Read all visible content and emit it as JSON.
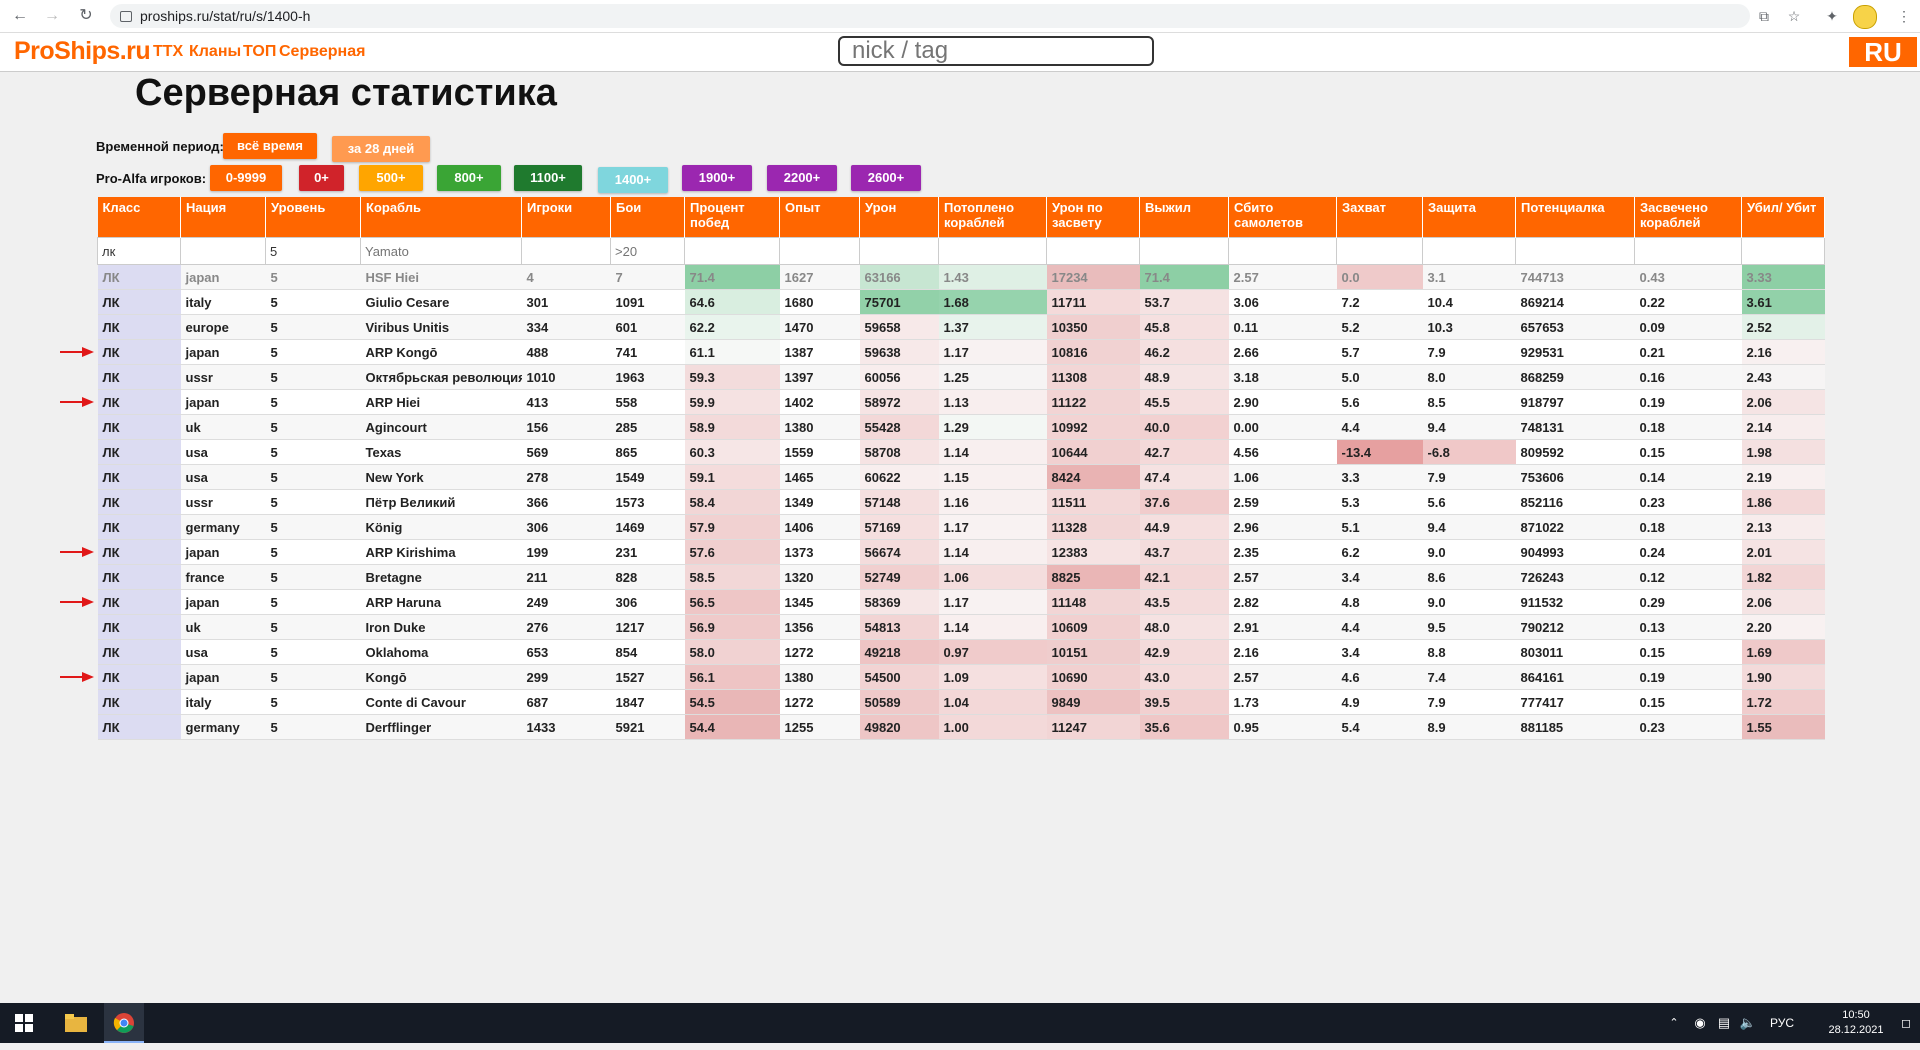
{
  "browser": {
    "url": "proships.ru/stat/ru/s/1400-h",
    "back_icon": "arrow-left-icon",
    "forward_icon": "arrow-right-icon",
    "reload_icon": "reload-icon",
    "toolbar_icons": [
      "share-icon",
      "star-icon",
      "puzzle-icon",
      "profile-icon"
    ]
  },
  "site": {
    "logo": "ProShips.ru",
    "menu": [
      "ТТХ",
      "Кланы",
      "ТОП",
      "Серверная"
    ],
    "search_placeholder": "nick / tag",
    "lang": "RU",
    "accent_color": "#ff6600"
  },
  "page": {
    "title": "Серверная статистика",
    "period_label": "Временной период:",
    "period_buttons": [
      {
        "label": "всё время",
        "color": "#ff6600",
        "active": true
      },
      {
        "label": "за 28 дней",
        "color": "#ff9a50",
        "active": false
      }
    ],
    "skill_label": "Pro-Alfa игроков:",
    "skill_buttons": [
      {
        "label": "0-9999",
        "color": "#ff6600"
      },
      {
        "label": "0+",
        "color": "#d0232a"
      },
      {
        "label": "500+",
        "color": "#ffa500"
      },
      {
        "label": "800+",
        "color": "#3aa535"
      },
      {
        "label": "1100+",
        "color": "#1f7a2e"
      },
      {
        "label": "1400+",
        "color": "#7fd6dd",
        "active": true
      },
      {
        "label": "1900+",
        "color": "#9b27b0"
      },
      {
        "label": "2200+",
        "color": "#9b27b0"
      },
      {
        "label": "2600+",
        "color": "#9b27b0"
      }
    ]
  },
  "table": {
    "headers": [
      "Класс",
      "Нация",
      "Уровень",
      "Корабль",
      "Игроки",
      "Бои",
      "Процент побед",
      "Опыт",
      "Урон",
      "Потоплено кораблей",
      "Урон по засвету",
      "Выжил",
      "Сбито самолетов",
      "Захват",
      "Защита",
      "Потенциалка",
      "Засвечено кораблей",
      "Убил/ Убит"
    ],
    "filters": [
      {
        "value": "лк",
        "placeholder": ""
      },
      {
        "value": "",
        "placeholder": ""
      },
      {
        "value": "5",
        "placeholder": ""
      },
      {
        "value": "",
        "placeholder": "Yamato"
      },
      {
        "value": "",
        "placeholder": ""
      },
      {
        "value": "",
        "placeholder": ">20"
      },
      {
        "value": "",
        "placeholder": ""
      },
      {
        "value": "",
        "placeholder": ""
      },
      {
        "value": "",
        "placeholder": ""
      },
      {
        "value": "",
        "placeholder": ""
      },
      {
        "value": "",
        "placeholder": ""
      },
      {
        "value": "",
        "placeholder": ""
      },
      {
        "value": "",
        "placeholder": ""
      },
      {
        "value": "",
        "placeholder": ""
      },
      {
        "value": "",
        "placeholder": ""
      },
      {
        "value": "",
        "placeholder": ""
      },
      {
        "value": "",
        "placeholder": ""
      },
      {
        "value": "",
        "placeholder": ""
      }
    ],
    "rows": [
      {
        "muted": true,
        "cells": [
          "ЛК",
          "japan",
          "5",
          "HSF Hiei",
          "4",
          "7",
          "71.4",
          "1627",
          "63166",
          "1.43",
          "17234",
          "71.4",
          "2.57",
          "0.0",
          "3.1",
          "744713",
          "0.43",
          "3.33"
        ],
        "colors": {
          "6": "#8dcfa5",
          "8": "#c7e6d2",
          "9": "#dff0e5",
          "10": "#e9bcbc",
          "11": "#8dcfa5",
          "13": "#efcaca",
          "17": "#8dcfa5"
        }
      },
      {
        "cells": [
          "ЛК",
          "italy",
          "5",
          "Giulio Cesare",
          "301",
          "1091",
          "64.6",
          "1680",
          "75701",
          "1.68",
          "11711",
          "53.7",
          "3.06",
          "7.2",
          "10.4",
          "869214",
          "0.22",
          "3.61"
        ],
        "colors": {
          "6": "#d9eee0",
          "8": "#92d1a9",
          "9": "#96d3ad",
          "10": "#f4dada",
          "11": "#f5e2e2",
          "17": "#92d1a9"
        }
      },
      {
        "cells": [
          "ЛК",
          "europe",
          "5",
          "Viribus Unitis",
          "334",
          "601",
          "62.2",
          "1470",
          "59658",
          "1.37",
          "10350",
          "45.8",
          "0.11",
          "5.2",
          "10.3",
          "657653",
          "0.09",
          "2.52"
        ],
        "colors": {
          "6": "#e9f4ed",
          "8": "#f7e9e9",
          "9": "#e8f3ec",
          "10": "#f0cfcf",
          "11": "#f5e0e0",
          "17": "#e3f1e8"
        }
      },
      {
        "arrow": true,
        "cells": [
          "ЛК",
          "japan",
          "5",
          "ARP Kongō",
          "488",
          "741",
          "61.1",
          "1387",
          "59638",
          "1.17",
          "10816",
          "46.2",
          "2.66",
          "5.7",
          "7.9",
          "929531",
          "0.21",
          "2.16"
        ],
        "colors": {
          "6": "#f6f8f6",
          "8": "#f7e9e9",
          "9": "#f8f2f2",
          "10": "#f1d2d2",
          "11": "#f5e0e0",
          "17": "#f8f0f0"
        }
      },
      {
        "cells": [
          "ЛК",
          "ussr",
          "5",
          "Октябрьская революция",
          "1010",
          "1963",
          "59.3",
          "1397",
          "60056",
          "1.25",
          "11308",
          "48.9",
          "3.18",
          "5.0",
          "8.0",
          "868259",
          "0.16",
          "2.43"
        ],
        "colors": {
          "6": "#f3dcdc",
          "8": "#f8eded",
          "9": "#f6f4f4",
          "10": "#f2d6d6",
          "11": "#f5e4e4",
          "17": "#f6f4f4"
        }
      },
      {
        "arrow": true,
        "cells": [
          "ЛК",
          "japan",
          "5",
          "ARP Hiei",
          "413",
          "558",
          "59.9",
          "1402",
          "58972",
          "1.13",
          "11122",
          "45.5",
          "2.90",
          "5.6",
          "8.5",
          "918797",
          "0.19",
          "2.06"
        ],
        "colors": {
          "6": "#f5e2e2",
          "8": "#f6e4e4",
          "9": "#f8eeee",
          "10": "#f2d4d4",
          "11": "#f5dfdf",
          "17": "#f5e4e4"
        }
      },
      {
        "cells": [
          "ЛК",
          "uk",
          "5",
          "Agincourt",
          "156",
          "285",
          "58.9",
          "1380",
          "55428",
          "1.29",
          "10992",
          "40.0",
          "0.00",
          "4.4",
          "9.4",
          "748131",
          "0.18",
          "2.14"
        ],
        "colors": {
          "6": "#f3dada",
          "8": "#f3d8d8",
          "9": "#f3f7f4",
          "10": "#f2d3d3",
          "11": "#f2d1d1",
          "17": "#f7eded"
        }
      },
      {
        "cells": [
          "ЛК",
          "usa",
          "5",
          "Texas",
          "569",
          "865",
          "60.3",
          "1559",
          "58708",
          "1.14",
          "10644",
          "42.7",
          "4.56",
          "-13.4",
          "-6.8",
          "809592",
          "0.15",
          "1.98"
        ],
        "colors": {
          "6": "#f6e6e6",
          "8": "#f6e3e3",
          "9": "#f8efef",
          "10": "#f1d0d0",
          "11": "#f4d9d9",
          "13": "#e6a0a0",
          "14": "#f0c8c8",
          "17": "#f4e0e0"
        }
      },
      {
        "cells": [
          "ЛК",
          "usa",
          "5",
          "New York",
          "278",
          "1549",
          "59.1",
          "1465",
          "60622",
          "1.15",
          "8424",
          "47.4",
          "1.06",
          "3.3",
          "7.9",
          "753606",
          "0.14",
          "2.19"
        ],
        "colors": {
          "6": "#f4dcdc",
          "8": "#f8eeee",
          "9": "#f8f0f0",
          "10": "#e9b3b3",
          "11": "#f5e2e2",
          "17": "#f8f0f0"
        }
      },
      {
        "cells": [
          "ЛК",
          "ussr",
          "5",
          "Пётр Великий",
          "366",
          "1573",
          "58.4",
          "1349",
          "57148",
          "1.16",
          "11511",
          "37.6",
          "2.59",
          "5.3",
          "5.6",
          "852116",
          "0.23",
          "1.86"
        ],
        "colors": {
          "6": "#f2d6d6",
          "8": "#f5dfdf",
          "9": "#f8f0f0",
          "10": "#f3d8d8",
          "11": "#f1cccc",
          "17": "#f3d8d8"
        }
      },
      {
        "cells": [
          "ЛК",
          "germany",
          "5",
          "König",
          "306",
          "1469",
          "57.9",
          "1406",
          "57169",
          "1.17",
          "11328",
          "44.9",
          "2.96",
          "5.1",
          "9.4",
          "871022",
          "0.18",
          "2.13"
        ],
        "colors": {
          "6": "#f1d1d1",
          "8": "#f5dfdf",
          "9": "#f8f2f2",
          "10": "#f2d6d6",
          "11": "#f5dfdf",
          "17": "#f7ecec"
        }
      },
      {
        "arrow": true,
        "cells": [
          "ЛК",
          "japan",
          "5",
          "ARP Kirishima",
          "199",
          "231",
          "57.6",
          "1373",
          "56674",
          "1.14",
          "12383",
          "43.7",
          "2.35",
          "6.2",
          "9.0",
          "904993",
          "0.24",
          "2.01"
        ],
        "colors": {
          "6": "#f0cfcf",
          "8": "#f4dcdc",
          "9": "#f8efef",
          "10": "#f6e3e3",
          "11": "#f4dcdc",
          "17": "#f5e3e3"
        }
      },
      {
        "cells": [
          "ЛК",
          "france",
          "5",
          "Bretagne",
          "211",
          "828",
          "58.5",
          "1320",
          "52749",
          "1.06",
          "8825",
          "42.1",
          "2.57",
          "3.4",
          "8.6",
          "726243",
          "0.12",
          "1.82"
        ],
        "colors": {
          "6": "#f2d7d7",
          "8": "#f1cfcf",
          "9": "#f4dddd",
          "10": "#eab6b6",
          "11": "#f3d7d7",
          "17": "#f2d5d5"
        }
      },
      {
        "arrow": true,
        "cells": [
          "ЛК",
          "japan",
          "5",
          "ARP Haruna",
          "249",
          "306",
          "56.5",
          "1345",
          "58369",
          "1.17",
          "11148",
          "43.5",
          "2.82",
          "4.8",
          "9.0",
          "911532",
          "0.29",
          "2.06"
        ],
        "colors": {
          "6": "#eec6c6",
          "8": "#f6e6e6",
          "9": "#f8f2f2",
          "10": "#f2d5d5",
          "11": "#f4dcdc",
          "17": "#f5e4e4"
        }
      },
      {
        "cells": [
          "ЛК",
          "uk",
          "5",
          "Iron Duke",
          "276",
          "1217",
          "56.9",
          "1356",
          "54813",
          "1.14",
          "10609",
          "48.0",
          "2.91",
          "4.4",
          "9.5",
          "790212",
          "0.13",
          "2.20"
        ],
        "colors": {
          "6": "#efcaca",
          "8": "#f2d4d4",
          "9": "#f8efef",
          "10": "#f1d0d0",
          "11": "#f5e2e2",
          "17": "#f8f1f1"
        }
      },
      {
        "cells": [
          "ЛК",
          "usa",
          "5",
          "Oklahoma",
          "653",
          "854",
          "58.0",
          "1272",
          "49218",
          "0.97",
          "10151",
          "42.9",
          "2.16",
          "3.4",
          "8.8",
          "803011",
          "0.15",
          "1.69"
        ],
        "colors": {
          "6": "#f1d2d2",
          "8": "#eec4c4",
          "9": "#f0cbcb",
          "10": "#efcdcd",
          "11": "#f4dbdb",
          "17": "#efc9c9"
        }
      },
      {
        "arrow": true,
        "cells": [
          "ЛК",
          "japan",
          "5",
          "Kongō",
          "299",
          "1527",
          "56.1",
          "1380",
          "54500",
          "1.09",
          "10690",
          "43.0",
          "2.57",
          "4.6",
          "7.4",
          "864161",
          "0.19",
          "1.90"
        ],
        "colors": {
          "6": "#eec4c4",
          "8": "#f2d3d3",
          "9": "#f5e0e0",
          "10": "#f1d0d0",
          "11": "#f4dbdb",
          "17": "#f3dada"
        }
      },
      {
        "cells": [
          "ЛК",
          "italy",
          "5",
          "Conte di Cavour",
          "687",
          "1847",
          "54.5",
          "1272",
          "50589",
          "1.04",
          "9849",
          "39.5",
          "1.73",
          "4.9",
          "7.9",
          "777417",
          "0.15",
          "1.72"
        ],
        "colors": {
          "6": "#e9b7b7",
          "8": "#efc9c9",
          "9": "#f3d8d8",
          "10": "#edc2c2",
          "11": "#f2d0d0",
          "17": "#f0cccc"
        }
      },
      {
        "cells": [
          "ЛК",
          "germany",
          "5",
          "Derfflinger",
          "1433",
          "5921",
          "54.4",
          "1255",
          "49820",
          "1.00",
          "11247",
          "35.6",
          "0.95",
          "5.4",
          "8.9",
          "881185",
          "0.23",
          "1.55"
        ],
        "colors": {
          "6": "#e9b6b6",
          "8": "#eec6c6",
          "9": "#f3d9d9",
          "10": "#f2d5d5",
          "11": "#efc7c7",
          "17": "#eabcbc"
        }
      }
    ]
  },
  "taskbar": {
    "start_icon": "windows-icon",
    "apps": [
      "file-explorer-icon",
      "chrome-icon"
    ],
    "tray_icons": [
      "chevron-up-icon",
      "steam-icon",
      "network-icon",
      "volume-icon"
    ],
    "lang": "РУС",
    "time": "10:50",
    "date": "28.12.2021"
  }
}
